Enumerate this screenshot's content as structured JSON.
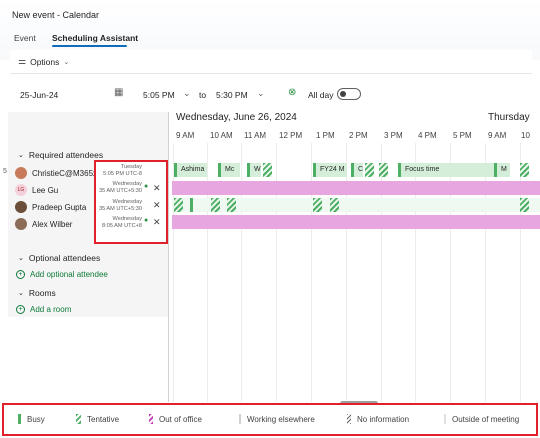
{
  "window": {
    "title": "New event - Calendar"
  },
  "tabs": [
    {
      "label": "Event"
    },
    {
      "label": "Scheduling Assistant"
    }
  ],
  "toolbar": {
    "options_label": "Options"
  },
  "date_row": {
    "date": "25-Jun-24",
    "start_time": "5:05 PM",
    "to_label": "to",
    "end_time": "5:30 PM",
    "all_day_label": "All day"
  },
  "grid": {
    "day1": "Wednesday, June 26, 2024",
    "day2": "Thursday",
    "hours": [
      "9 AM",
      "10 AM",
      "11 AM",
      "12 PM",
      "1 PM",
      "2 PM",
      "3 PM",
      "4 PM",
      "5 PM",
      "9 AM",
      "10"
    ],
    "row1_events": [
      "Ashima",
      "Mc",
      "W",
      "FY24 M",
      "C",
      "Focus time",
      "M"
    ]
  },
  "attendees": {
    "required_label": "Required attendees",
    "required": [
      {
        "name": "ChristieC@M365x3",
        "initials": "",
        "tz_line1": "Tuesday",
        "tz_line2": "5:05 PM UTC-8"
      },
      {
        "name": "Lee Gu",
        "initials": "LG",
        "tz_line1": "Wednesday",
        "tz_line2": "35 AM UTC+5:30"
      },
      {
        "name": "Pradeep Gupta",
        "initials": "",
        "tz_line1": "Wednesday",
        "tz_line2": "35 AM UTC+5:30"
      },
      {
        "name": "Alex Wilber",
        "initials": "",
        "tz_line1": "Wednesday",
        "tz_line2": "8:05 AM UTC+8"
      }
    ],
    "row_marker": "5",
    "optional_label": "Optional attendees",
    "add_optional": "Add optional attendee",
    "rooms_label": "Rooms",
    "add_room": "Add a room"
  },
  "legend": [
    {
      "label": "Busy",
      "color": "#4caf63"
    },
    {
      "label": "Tentative",
      "color": "#4caf63"
    },
    {
      "label": "Out of office",
      "color": "#c239b3"
    },
    {
      "label": "Working elsewhere",
      "color": "#d1d1d1"
    },
    {
      "label": "No information",
      "color": "#616161"
    },
    {
      "label": "Outside of meeting",
      "color": "#e0e0e0"
    }
  ],
  "colors": {
    "accent": "#0f6cbd",
    "busy": "#d4eed9",
    "ooo": "#e8a6e0",
    "highlight": "#e0202a"
  }
}
